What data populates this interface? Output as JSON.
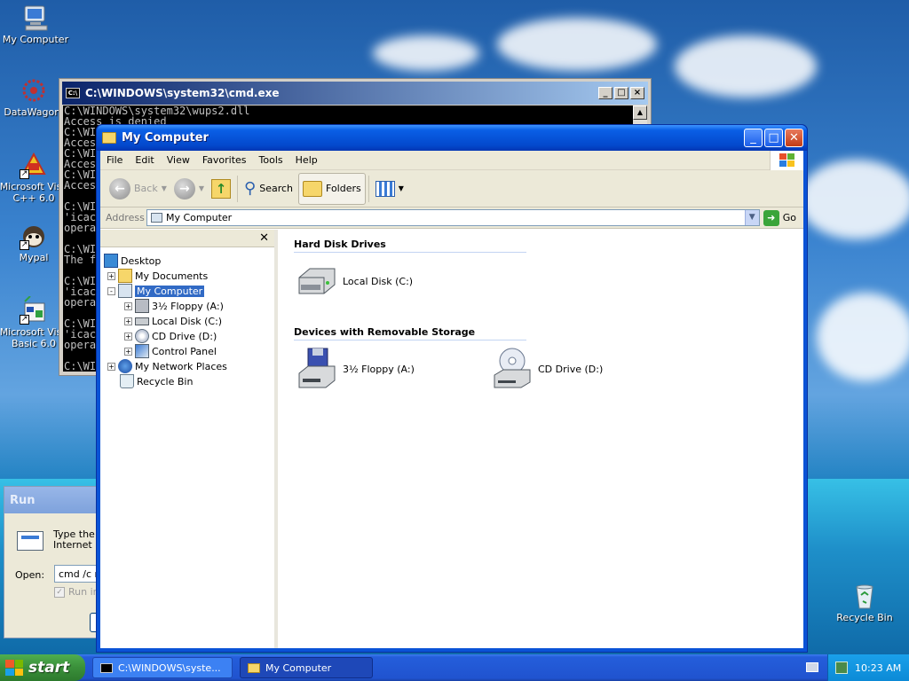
{
  "desktop": {
    "icons": [
      {
        "label": "My Computer",
        "icon": "my-computer-icon"
      },
      {
        "label": "DataWagon.",
        "icon": "datawagon-icon"
      },
      {
        "label": "Microsoft Visu C++ 6.0",
        "icon": "visual-cpp-icon"
      },
      {
        "label": "Mypal",
        "icon": "mypal-icon"
      },
      {
        "label": "Microsoft Visu Basic 6.0",
        "icon": "visual-basic-icon"
      },
      {
        "label": "Recycle Bin",
        "icon": "recycle-bin-icon"
      }
    ]
  },
  "cmd": {
    "title": "C:\\WINDOWS\\system32\\cmd.exe",
    "lines": "C:\\WINDOWS\\system32\\wups2.dll\nAccess is denied\nC:\\WI\nAcces\nC:\\WI\nAcces\nC:\\WI\nAcces\n\nC:\\WI\n'icac\nopera\n\nC:\\WI\nThe f\n\nC:\\WI\n'icac\nopera\n\nC:\\WI\n'icac\nopera\n\nC:\\WI"
  },
  "run": {
    "title": "Run",
    "desc": "Type the n\nInternet re",
    "open_label": "Open:",
    "open_value": "cmd /c rd",
    "separate_label": "Run in s"
  },
  "explorer": {
    "title": "My Computer",
    "menu": [
      "File",
      "Edit",
      "View",
      "Favorites",
      "Tools",
      "Help"
    ],
    "toolbar": {
      "back": "Back",
      "search": "Search",
      "folders": "Folders"
    },
    "address": {
      "label": "Address",
      "value": "My Computer",
      "go": "Go"
    },
    "tree": [
      {
        "label": "Desktop",
        "level": 0,
        "expander": ""
      },
      {
        "label": "My Documents",
        "level": 1,
        "expander": "+"
      },
      {
        "label": "My Computer",
        "level": 1,
        "expander": "-"
      },
      {
        "label": "3½ Floppy (A:)",
        "level": 2,
        "expander": "+"
      },
      {
        "label": "Local Disk (C:)",
        "level": 2,
        "expander": "+"
      },
      {
        "label": "CD Drive (D:)",
        "level": 2,
        "expander": "+"
      },
      {
        "label": "Control Panel",
        "level": 2,
        "expander": "+"
      },
      {
        "label": "My Network Places",
        "level": 1,
        "expander": "+"
      },
      {
        "label": "Recycle Bin",
        "level": 1,
        "expander": ""
      }
    ],
    "groups": {
      "hdd": "Hard Disk Drives",
      "removable": "Devices with Removable Storage"
    },
    "items": {
      "local_disk": "Local Disk (C:)",
      "floppy": "3½ Floppy (A:)",
      "cd": "CD Drive (D:)"
    }
  },
  "taskbar": {
    "start": "start",
    "tasks": [
      "C:\\WINDOWS\\syste...",
      "My Computer"
    ],
    "clock": "10:23 AM"
  }
}
